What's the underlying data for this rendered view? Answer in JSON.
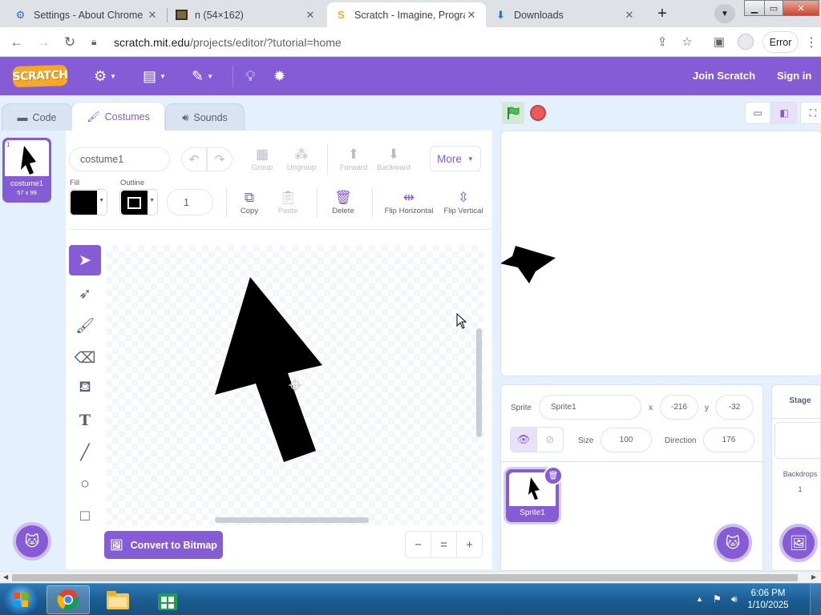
{
  "browser": {
    "tabs": [
      {
        "title": "Settings - About Chrome",
        "icon": "gear-icon"
      },
      {
        "title": "n (54×162)",
        "icon": "image-icon"
      },
      {
        "title": "Scratch - Imagine, Progra",
        "icon": "scratch-icon"
      },
      {
        "title": "Downloads",
        "icon": "download-icon"
      }
    ],
    "url_host": "scratch.mit.edu",
    "url_path": "/projects/editor/?tutorial=home",
    "error_label": "Error"
  },
  "menubar": {
    "logo": "SCRATCH",
    "join": "Join Scratch",
    "signin": "Sign in",
    "accent": "#855cd6"
  },
  "editor": {
    "tabs": {
      "code": "Code",
      "costumes": "Costumes",
      "sounds": "Sounds"
    },
    "costume": {
      "index": "1",
      "name": "costume1",
      "size": "57 x 99"
    },
    "name_value": "costume1",
    "toolbar": {
      "group": "Group",
      "ungroup": "Ungroup",
      "forward": "Forward",
      "backward": "Backward",
      "more": "More",
      "copy": "Copy",
      "paste": "Paste",
      "delete": "Delete",
      "flip_h": "Flip Horizontal",
      "flip_v": "Flip Vertical"
    },
    "fill_label": "Fill",
    "outline_label": "Outline",
    "outline_width": "1",
    "convert_label": "Convert to Bitmap",
    "zoom": {
      "out": "−",
      "reset": "=",
      "in": "+"
    }
  },
  "sprite": {
    "label": "Sprite",
    "name": "Sprite1",
    "x_label": "x",
    "x": "-216",
    "y_label": "y",
    "y": "-32",
    "size_label": "Size",
    "size": "100",
    "direction_label": "Direction",
    "direction": "176"
  },
  "stage_panel": {
    "title": "Stage",
    "backdrops_label": "Backdrops",
    "backdrops_count": "1"
  },
  "taskbar": {
    "time": "6:06 PM",
    "date": "1/10/2025"
  }
}
